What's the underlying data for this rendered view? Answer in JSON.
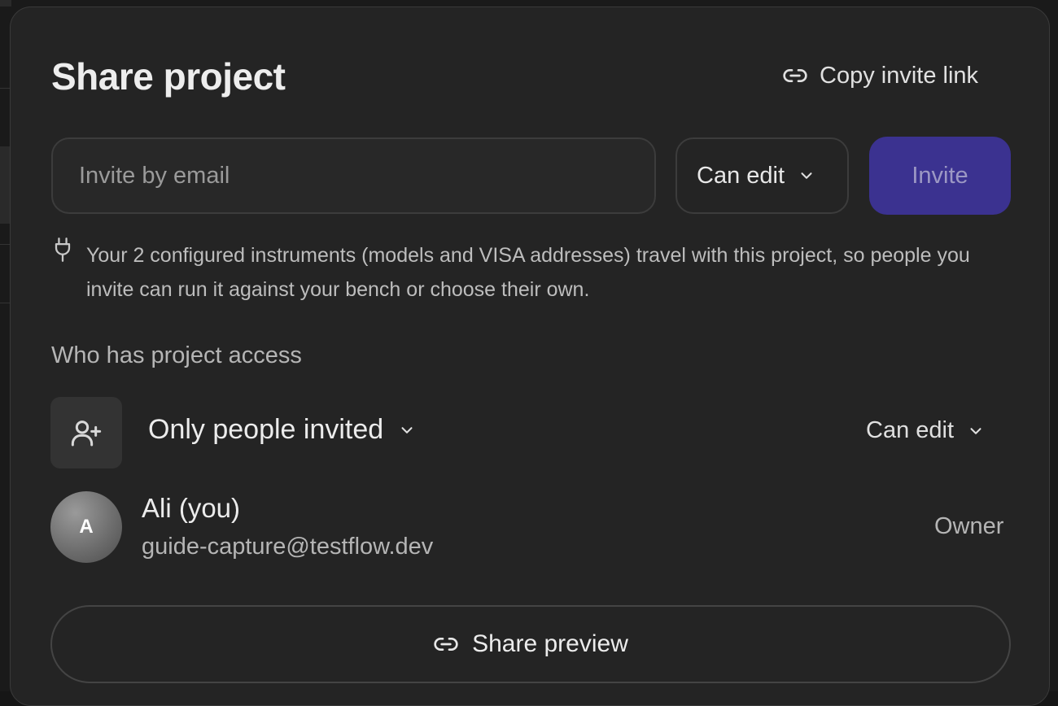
{
  "modal": {
    "title": "Share project",
    "copy_link_label": "Copy invite link",
    "email_placeholder": "Invite by email",
    "permission_select": "Can edit",
    "invite_label": "Invite",
    "notice_text": "Your 2 configured instruments (models and VISA addresses) travel with this project, so people you invite can run it against your bench or choose their own.",
    "access_section_label": "Who has project access",
    "access_mode": "Only people invited",
    "access_permission": "Can edit",
    "member": {
      "initial": "A",
      "name": "Ali (you)",
      "email": "guide-capture@testflow.dev",
      "role": "Owner"
    },
    "share_preview_label": "Share preview"
  },
  "colors": {
    "modal_bg": "#242424",
    "invite_button_bg": "#3b3290",
    "invite_button_text": "#9c98c4"
  },
  "icons": {
    "copy_link": "link-icon",
    "notice": "plug-icon",
    "access": "user-plus-icon",
    "dropdown": "chevron-down-icon",
    "share_preview": "link-icon"
  }
}
